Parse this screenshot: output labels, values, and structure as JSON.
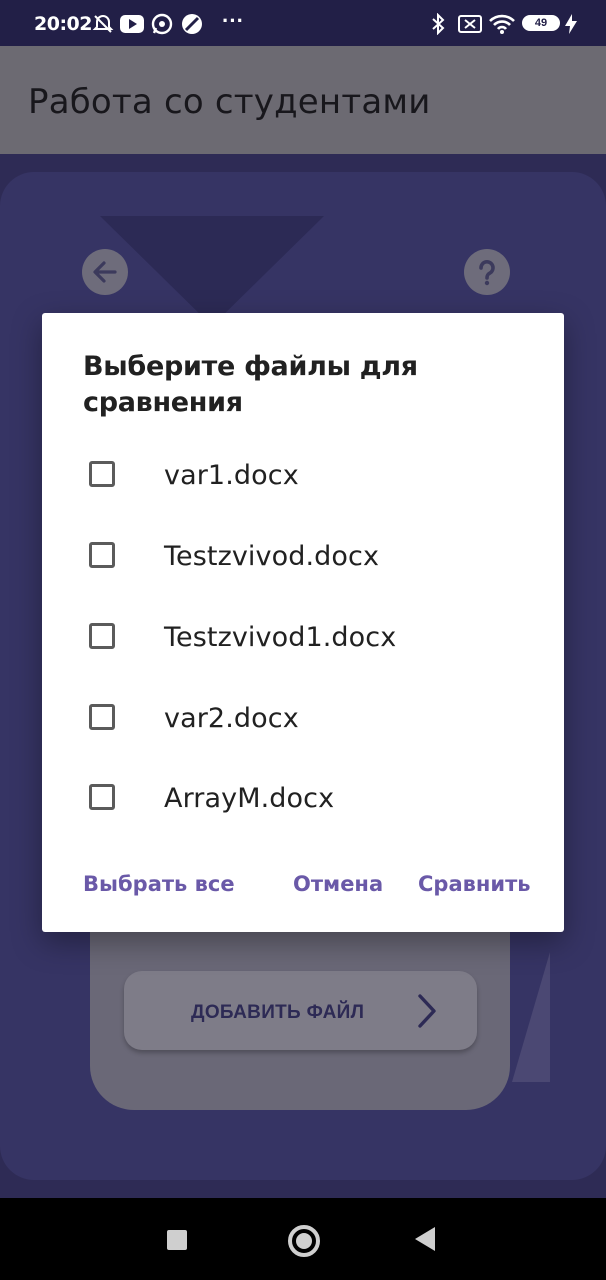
{
  "status_bar": {
    "time": "20:02",
    "overflow": "···",
    "battery_level": "49",
    "icons": [
      "alarm-off-icon",
      "youtube-icon",
      "whatsapp-icon",
      "app-icon",
      "bluetooth-icon",
      "sim-off-icon",
      "wifi-icon",
      "battery-icon",
      "charging-icon"
    ]
  },
  "app_bar": {
    "title": "Работа со студентами"
  },
  "background": {
    "add_file_label": "ДОБАВИТЬ ФАЙЛ"
  },
  "dialog": {
    "title": "Выберите файлы для сравнения",
    "files": [
      {
        "name": "var1.docx",
        "checked": false
      },
      {
        "name": "Testzvivod.docx",
        "checked": false
      },
      {
        "name": "Testzvivod1.docx",
        "checked": false
      },
      {
        "name": "var2.docx",
        "checked": false
      },
      {
        "name": "ArrayM.docx",
        "checked": false
      }
    ],
    "buttons": {
      "select_all": "Выбрать все",
      "cancel": "Отмена",
      "compare": "Сравнить"
    }
  },
  "colors": {
    "accent": "#6a59a8",
    "status_bar": "#221f47",
    "background": "#2e2b55"
  }
}
